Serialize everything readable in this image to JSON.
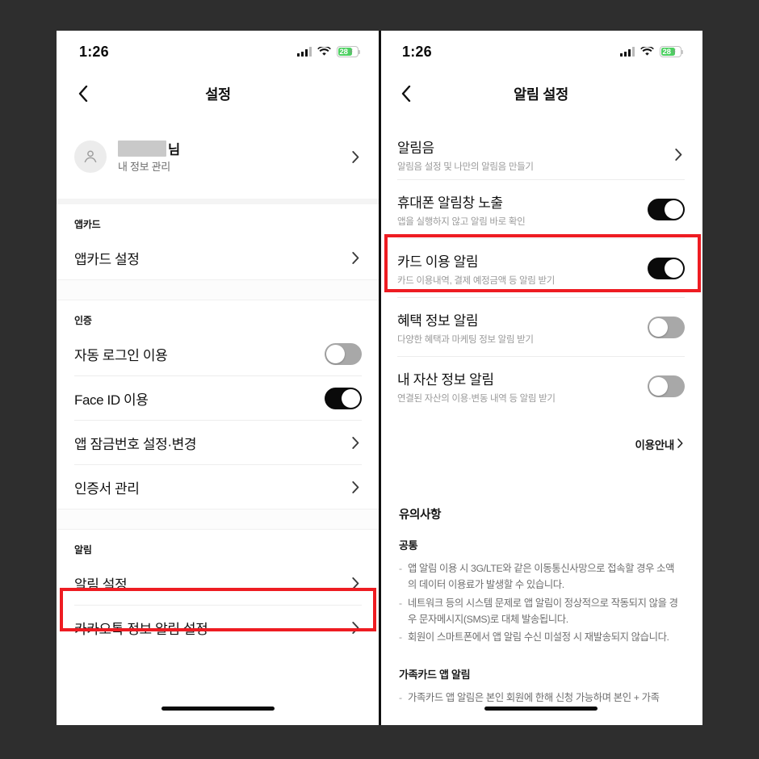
{
  "status": {
    "time": "1:26",
    "battery_level": "28",
    "battery_bolt": "⚡",
    "signal_icon": "cellular-bars-icon",
    "wifi_icon": "wifi-icon",
    "battery_icon": "battery-icon",
    "accent_green": "#4cd060"
  },
  "highlight_color": "#ee1c22",
  "left": {
    "nav": {
      "back_icon": "chevron-left-icon",
      "title": "설정"
    },
    "profile": {
      "avatar_icon": "person-icon",
      "name_suffix": "님",
      "subtitle": "내 정보 관리",
      "chevron_icon": "chevron-right-icon"
    },
    "sections": [
      {
        "label": "앱카드",
        "rows": [
          {
            "title": "앱카드 설정",
            "type": "link"
          }
        ]
      },
      {
        "label": "인증",
        "rows": [
          {
            "title": "자동 로그인 이용",
            "type": "toggle",
            "on": false
          },
          {
            "title": "Face ID 이용",
            "type": "toggle",
            "on": true
          },
          {
            "title": "앱 잠금번호 설정·변경",
            "type": "link"
          },
          {
            "title": "인증서 관리",
            "type": "link"
          }
        ]
      },
      {
        "label": "알림",
        "rows": [
          {
            "title": "알림 설정",
            "type": "link",
            "highlighted": true
          },
          {
            "title": "카카오톡 정보 알림 설정",
            "type": "link"
          }
        ]
      }
    ]
  },
  "right": {
    "nav": {
      "back_icon": "chevron-left-icon",
      "title": "알림 설정"
    },
    "rows": [
      {
        "title": "알림음",
        "sub": "알림음 설정 및 나만의 알림음 만들기",
        "type": "link"
      },
      {
        "title": "휴대폰 알림창 노출",
        "sub": "앱을 실행하지 않고 알림 바로 확인",
        "type": "toggle",
        "on": true
      },
      {
        "title": "카드 이용 알림",
        "sub": "카드 이용내역, 결제 예정금액 등 알림 받기",
        "type": "toggle",
        "on": true,
        "highlighted": true
      },
      {
        "title": "혜택 정보 알림",
        "sub": "다양한 혜택과 마케팅 정보 알림 받기",
        "type": "toggle",
        "on": false
      },
      {
        "title": "내 자산 정보 알림",
        "sub": "연결된 자산의 이용·변동 내역 등 알림 받기",
        "type": "toggle",
        "on": false
      }
    ],
    "guide_link": {
      "label": "이용안내",
      "chevron_icon": "chevron-right-icon"
    },
    "notice": {
      "title": "유의사항",
      "group_common": "공통",
      "common_bullets": [
        "앱 알림 이용 시 3G/LTE와 같은 이동통신사망으로 접속할 경우 소액의 데이터 이용료가 발생할 수 있습니다.",
        "네트워크 등의 시스템 문제로 앱 알림이 정상적으로 작동되지 않을 경우 문자메시지(SMS)로 대체 발송됩니다.",
        "회원이 스마트폰에서 앱 알림 수신 미설정 시 재발송되지 않습니다."
      ],
      "group_family": "가족카드 앱 알림",
      "family_bullets": [
        "가족카드 앱 알림은 본인 회원에 한해 신청 가능하며  본인 + 가족"
      ]
    }
  }
}
